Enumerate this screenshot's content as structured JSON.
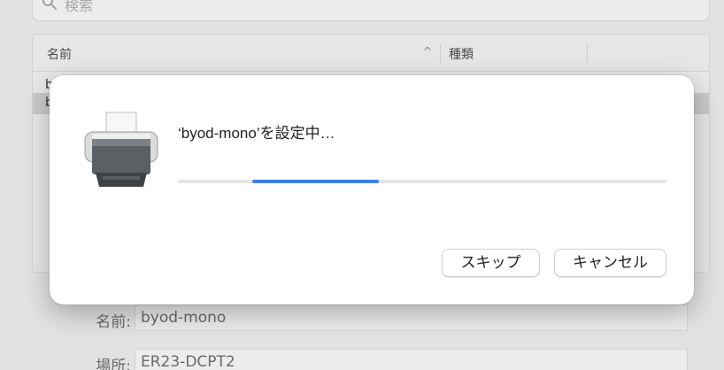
{
  "search": {
    "placeholder": "検索"
  },
  "printer_list": {
    "columns": {
      "name": "名前",
      "kind": "種類"
    },
    "sort_indicator": "^",
    "rows": [
      {
        "name": "b"
      },
      {
        "name": "b"
      }
    ]
  },
  "info": {
    "name_label": "名前:",
    "name_value": "byod-mono",
    "location_label": "場所:",
    "location_value": "ER23-DCPT2"
  },
  "dialog": {
    "title": "‘byod-mono’を設定中…",
    "progress_fraction": 0.26,
    "skip_label": "スキップ",
    "cancel_label": "キャンセル",
    "accent_color": "#3f7fe8",
    "icon": "printer-icon"
  }
}
